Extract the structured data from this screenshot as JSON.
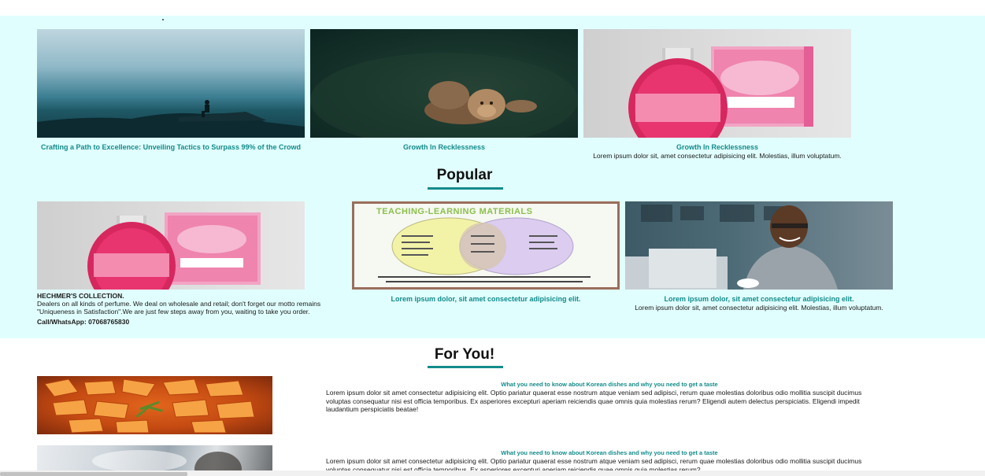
{
  "featured": [
    {
      "title": "Crafting a Path to Excellence: Unveiling Tactics to Surpass 99% of the Crowd",
      "text": "",
      "image": "fog-cliff-person"
    },
    {
      "title": "Growth In Recklessness",
      "text": "",
      "image": "lions-in-grass"
    },
    {
      "title": "Growth In Recklessness",
      "text": "Lorem ipsum dolor sit, amet consectetur adipisicing elit. Molestias, illum voluptatum.",
      "image": "perfume-bottle"
    }
  ],
  "popular": {
    "heading": "Popular",
    "cards": [
      {
        "title": "HECHMER'S COLLECTION.",
        "text": "Dealers on all kinds of perfume. We deal on wholesale and retail; don't forget our motto remains \"Uniqueness in Satisfaction\".We are just few steps away from you, waiting to take you order.",
        "contact": "Call/WhatsApp: 07068765830",
        "image": "perfume-bottle"
      },
      {
        "title": "Lorem ipsum dolor, sit amet consectetur adipisicing elit.",
        "text": "",
        "image": "teaching-learning-venn",
        "image_heading": "TEACHING-LEARNING MATERIALS"
      },
      {
        "title": "Lorem ipsum dolor, sit amet consectetur adipisicing elit.",
        "text": "Lorem ipsum dolor sit, amet consectetur adipisicing elit. Molestias, illum voluptatum.",
        "image": "man-with-laptop"
      }
    ]
  },
  "for_you": {
    "heading": "For You!",
    "items": [
      {
        "title": "What you need to know about Korean dishes and why you need to get a taste",
        "text": "Lorem ipsum dolor sit amet consectetur adipisicing elit. Optio pariatur quaerat esse nostrum atque veniam sed adipisci, rerum quae molestias doloribus odio mollitia suscipit ducimus voluptas consequatur nisi est officia temporibus. Ex asperiores excepturi aperiam reiciendis quae omnis quia molestias rerum? Eligendi autem delectus perspiciatis. Eligendi impedit laudantium perspiciatis beatae!",
        "image": "korean-dish"
      },
      {
        "title": "What you need to know about Korean dishes and why you need to get a taste",
        "text": "Lorem ipsum dolor sit amet consectetur adipisicing elit. Optio pariatur quaerat esse nostrum atque veniam sed adipisci, rerum quae molestias doloribus odio mollitia suscipit ducimus voluptas consequatur nisi est officia temporibus. Ex asperiores excepturi aperiam reiciendis quae omnis quia molestias rerum?",
        "image": "blurred-person"
      }
    ]
  },
  "colors": {
    "band": "#e1fefe",
    "accent": "#138b8b"
  }
}
